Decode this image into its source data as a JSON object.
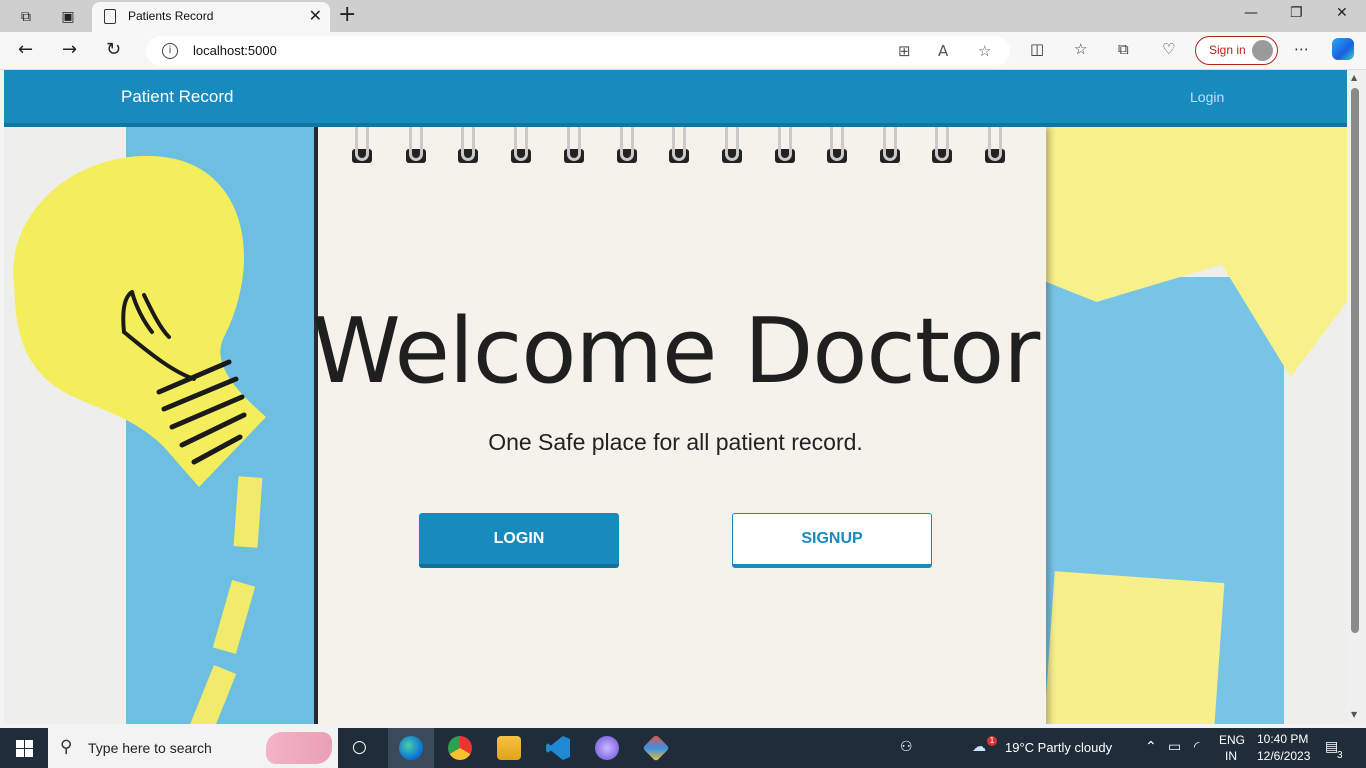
{
  "browser": {
    "tab_title": "Patients Record",
    "url": "localhost:5000",
    "signin_label": "Sign in"
  },
  "navbar": {
    "brand": "Patient Record",
    "login_link": "Login"
  },
  "hero": {
    "title": "Welcome Doctor",
    "subtitle": "One Safe place for all patient record.",
    "login_button": "LOGIN",
    "signup_button": "SIGNUP"
  },
  "taskbar": {
    "search_placeholder": "Type here to search",
    "weather": "19°C  Partly cloudy",
    "weather_badge": "1",
    "language_top": "ENG",
    "language_bottom": "IN",
    "time": "10:40 PM",
    "date": "12/6/2023",
    "notification_count": "3"
  },
  "colors": {
    "brand_blue": "#178bbe",
    "taskbar": "#1f2d3a"
  }
}
